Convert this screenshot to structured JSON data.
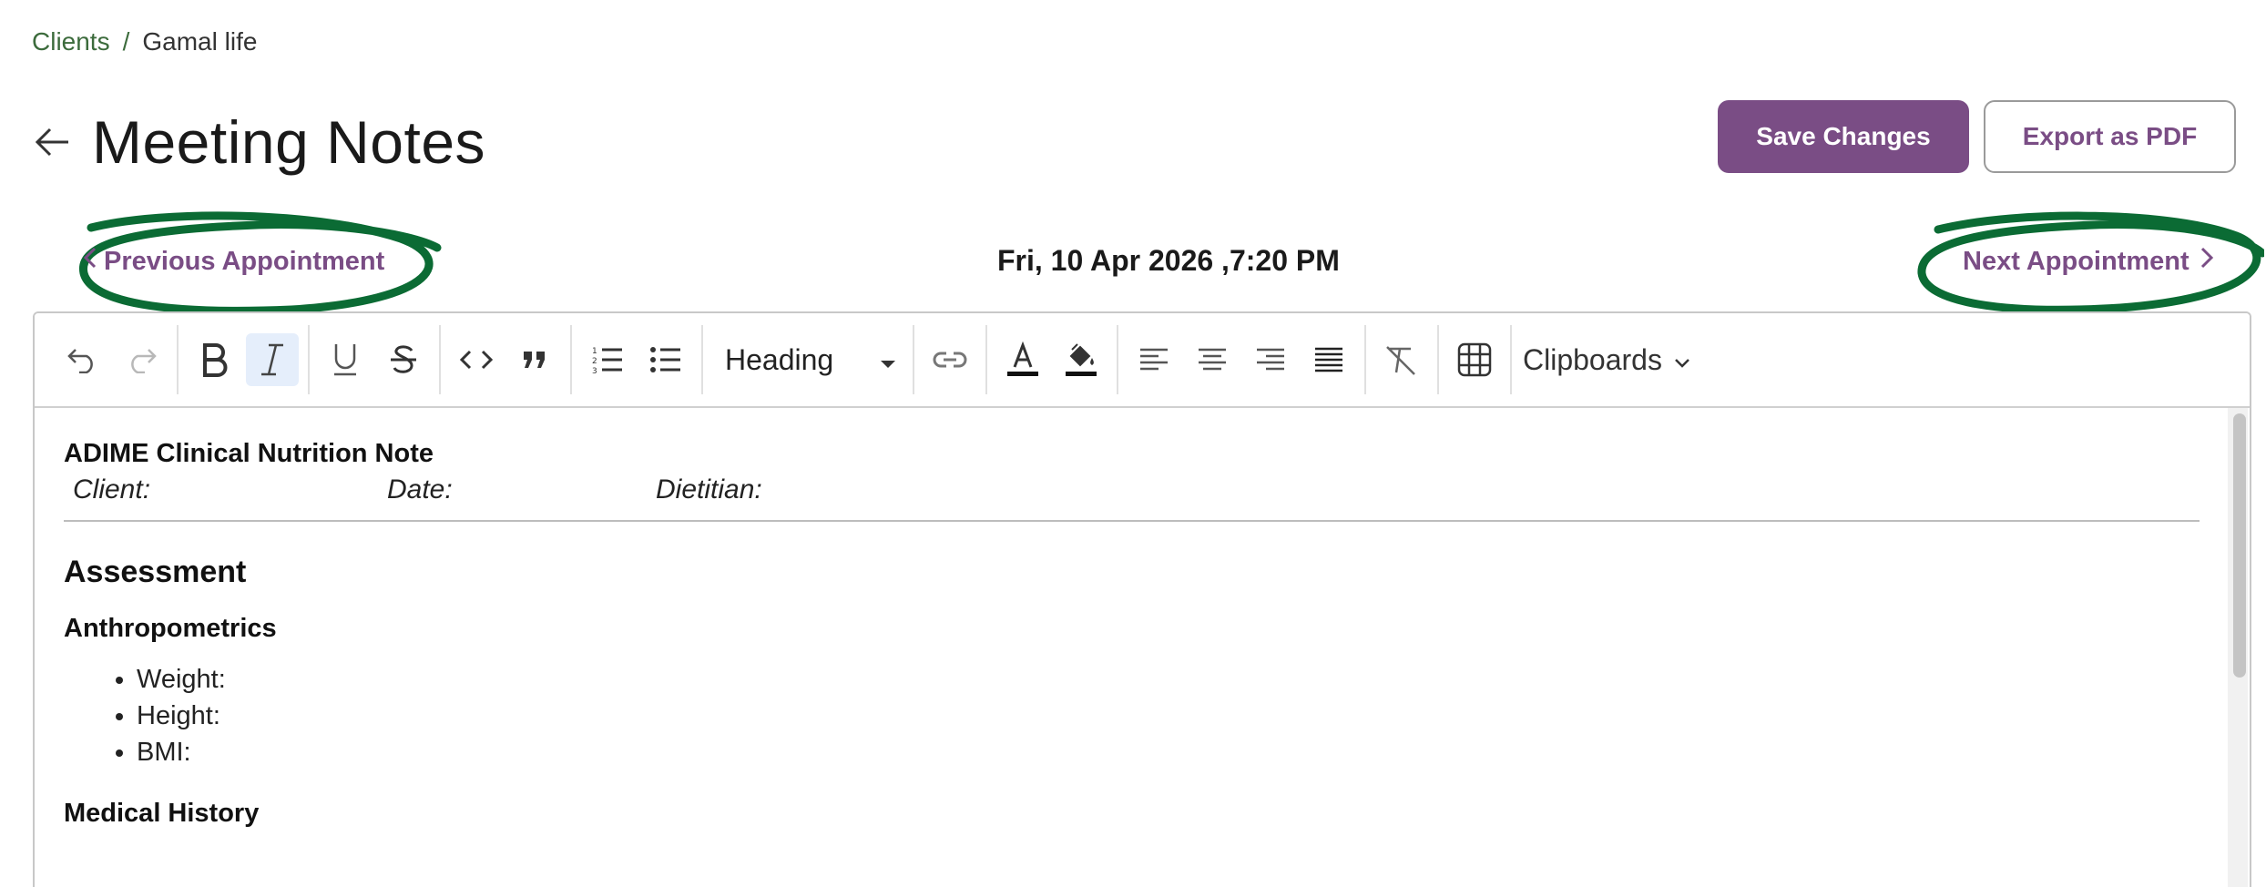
{
  "breadcrumb": {
    "parent": "Clients",
    "separator": "/",
    "current": "Gamal life"
  },
  "header": {
    "title": "Meeting Notes",
    "save_label": "Save Changes",
    "export_label": "Export as PDF"
  },
  "appointments": {
    "prev_label": "Previous Appointment",
    "next_label": "Next Appointment",
    "datetime": "Fri, 10 Apr 2026 ,7:20 PM"
  },
  "toolbar": {
    "heading_value": "Heading",
    "clipboards_label": "Clipboards"
  },
  "note": {
    "title": "ADIME Clinical Nutrition Note",
    "meta": {
      "client": "Client:",
      "date": "Date:",
      "dietitian": "Dietitian:"
    },
    "assessment": "Assessment",
    "anthropometrics": "Anthropometrics",
    "measures": [
      "Weight:",
      "Height:",
      "BMI:"
    ],
    "medical_history": "Medical History"
  },
  "colors": {
    "accent": "#7a4d85",
    "breadcrumb": "#3c6b3c",
    "highlight": "#0b6b34"
  }
}
